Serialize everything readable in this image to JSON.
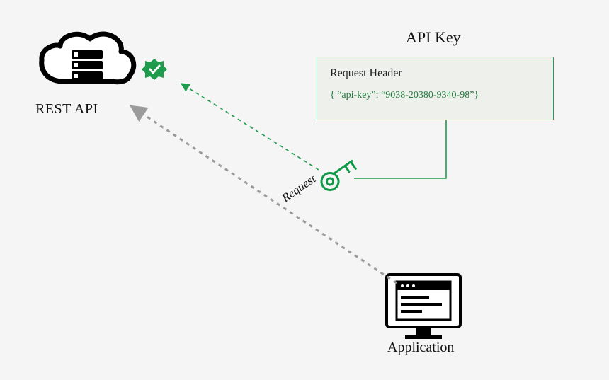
{
  "rest_api_label": "REST API",
  "api_key_title": "API Key",
  "header_box": {
    "title": "Request Header",
    "payload": "{ “api-key”: “9038-20380-9340-98”}"
  },
  "request_label": "Request",
  "application_label": "Application",
  "colors": {
    "green": "#1f9b4d",
    "green_dark": "#0e7a3a",
    "box_border": "#2c9b59",
    "box_bg": "#eef0ec",
    "grey": "#9b9b9b",
    "black": "#000000"
  }
}
